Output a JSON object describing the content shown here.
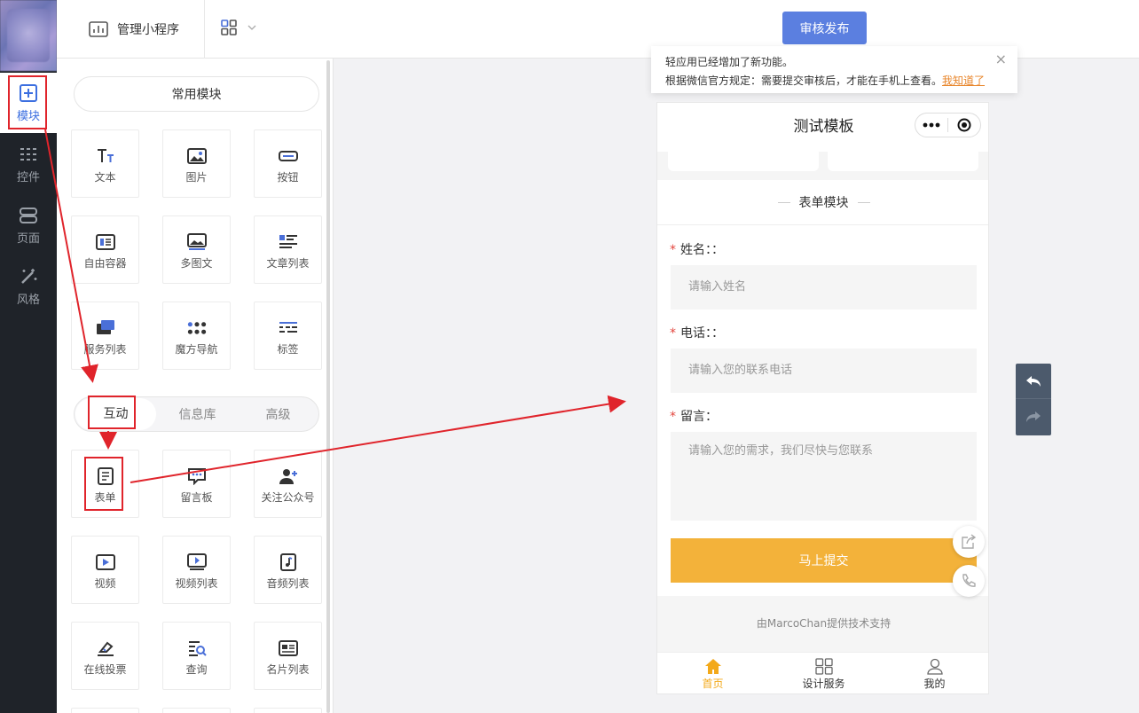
{
  "nav": {
    "items": [
      {
        "label": "模块",
        "icon": "plus-square-icon"
      },
      {
        "label": "控件",
        "icon": "sliders-icon"
      },
      {
        "label": "页面",
        "icon": "pages-icon"
      },
      {
        "label": "风格",
        "icon": "magic-wand-icon"
      }
    ]
  },
  "topbar": {
    "app_label": "管理小程序",
    "publish_label": "审核发布"
  },
  "palette": {
    "common_title": "常用模块",
    "common_items": [
      {
        "label": "文本",
        "icon": "text-icon"
      },
      {
        "label": "图片",
        "icon": "image-icon"
      },
      {
        "label": "按钮",
        "icon": "button-icon"
      },
      {
        "label": "自由容器",
        "icon": "container-icon"
      },
      {
        "label": "多图文",
        "icon": "multi-image-icon"
      },
      {
        "label": "文章列表",
        "icon": "article-list-icon"
      },
      {
        "label": "服务列表",
        "icon": "service-list-icon"
      },
      {
        "label": "魔方导航",
        "icon": "cube-nav-icon"
      },
      {
        "label": "标签",
        "icon": "tag-icon"
      }
    ],
    "tabs": [
      "互动",
      "信息库",
      "高级"
    ],
    "active_tab": "互动",
    "interactive_items": [
      {
        "label": "表单",
        "icon": "form-icon"
      },
      {
        "label": "留言板",
        "icon": "message-board-icon"
      },
      {
        "label": "关注公众号",
        "icon": "follow-icon"
      },
      {
        "label": "视频",
        "icon": "video-icon"
      },
      {
        "label": "视频列表",
        "icon": "video-list-icon"
      },
      {
        "label": "音频列表",
        "icon": "audio-list-icon"
      },
      {
        "label": "在线投票",
        "icon": "vote-icon"
      },
      {
        "label": "查询",
        "icon": "query-icon"
      },
      {
        "label": "名片列表",
        "icon": "card-list-icon"
      }
    ]
  },
  "notice": {
    "line1": "轻应用已经增加了新功能。",
    "line2": "根据微信官方规定：需要提交审核后，才能在手机上查看。",
    "link": "我知道了",
    "close": "×"
  },
  "phone": {
    "title": "测试模板",
    "section_title": "表单模块",
    "fields": [
      {
        "label": "姓名：：",
        "placeholder": "请输入姓名"
      },
      {
        "label": "电话：：",
        "placeholder": "请输入您的联系电话"
      },
      {
        "label": "留言：",
        "placeholder": "请输入您的需求，我们尽快与您联系"
      }
    ],
    "required_mark": "*",
    "submit_label": "马上提交",
    "support_text": "由MarcoChan提供技术支持",
    "tabbar": [
      {
        "label": "首页",
        "icon": "home-icon",
        "active": true
      },
      {
        "label": "设计服务",
        "icon": "grid-icon",
        "active": false
      },
      {
        "label": "我的",
        "icon": "user-icon",
        "active": false
      }
    ]
  },
  "colors": {
    "accent": "#5b7fe0",
    "submit": "#f3b23a",
    "annotation": "#e0242b",
    "nav_bg": "#1f2329"
  }
}
